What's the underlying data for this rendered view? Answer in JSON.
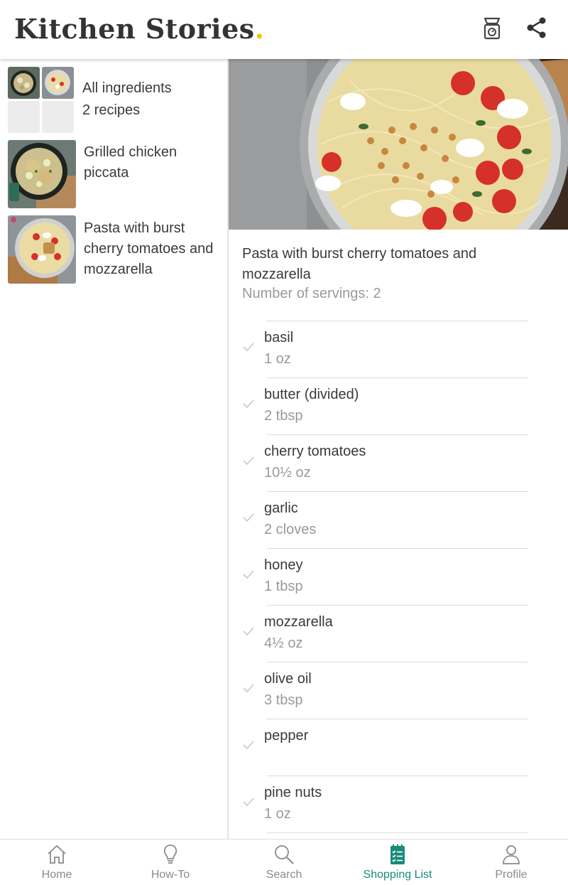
{
  "app": {
    "brand_name": "Kitchen Stories",
    "brand_dot": ".",
    "brand_dot_color": "#f2c500",
    "accent_color": "#1b8a78",
    "header_icons": [
      "kitchen-scale-icon",
      "share-icon"
    ]
  },
  "recipes_list": [
    {
      "title": "All ingredients",
      "subtitle": "2 recipes",
      "thumb": "collage"
    },
    {
      "title": "Grilled chicken piccata",
      "thumb": "chicken-piccata-photo"
    },
    {
      "title": "Pasta with burst cherry tomatoes and mozzarella",
      "thumb": "pasta-photo"
    }
  ],
  "detail": {
    "title": "Pasta with burst cherry tomatoes and mozzarella",
    "servings": "Number of servings: 2",
    "ingredients": [
      {
        "name": "basil",
        "qty": "1 oz"
      },
      {
        "name": "butter (divided)",
        "qty": "2 tbsp"
      },
      {
        "name": "cherry tomatoes",
        "qty": "10½ oz"
      },
      {
        "name": "garlic",
        "qty": "2 cloves"
      },
      {
        "name": "honey",
        "qty": "1 tbsp"
      },
      {
        "name": "mozzarella",
        "qty": "4½ oz"
      },
      {
        "name": "olive oil",
        "qty": "3 tbsp"
      },
      {
        "name": "pepper",
        "qty": ""
      },
      {
        "name": "pine nuts",
        "qty": "1 oz"
      }
    ]
  },
  "bottom_nav": [
    {
      "label": "Home",
      "icon": "home-icon",
      "active": false
    },
    {
      "label": "How-To",
      "icon": "lightbulb-icon",
      "active": false
    },
    {
      "label": "Search",
      "icon": "search-icon",
      "active": false
    },
    {
      "label": "Shopping List",
      "icon": "shopping-list-icon",
      "active": true
    },
    {
      "label": "Profile",
      "icon": "profile-icon",
      "active": false
    }
  ]
}
